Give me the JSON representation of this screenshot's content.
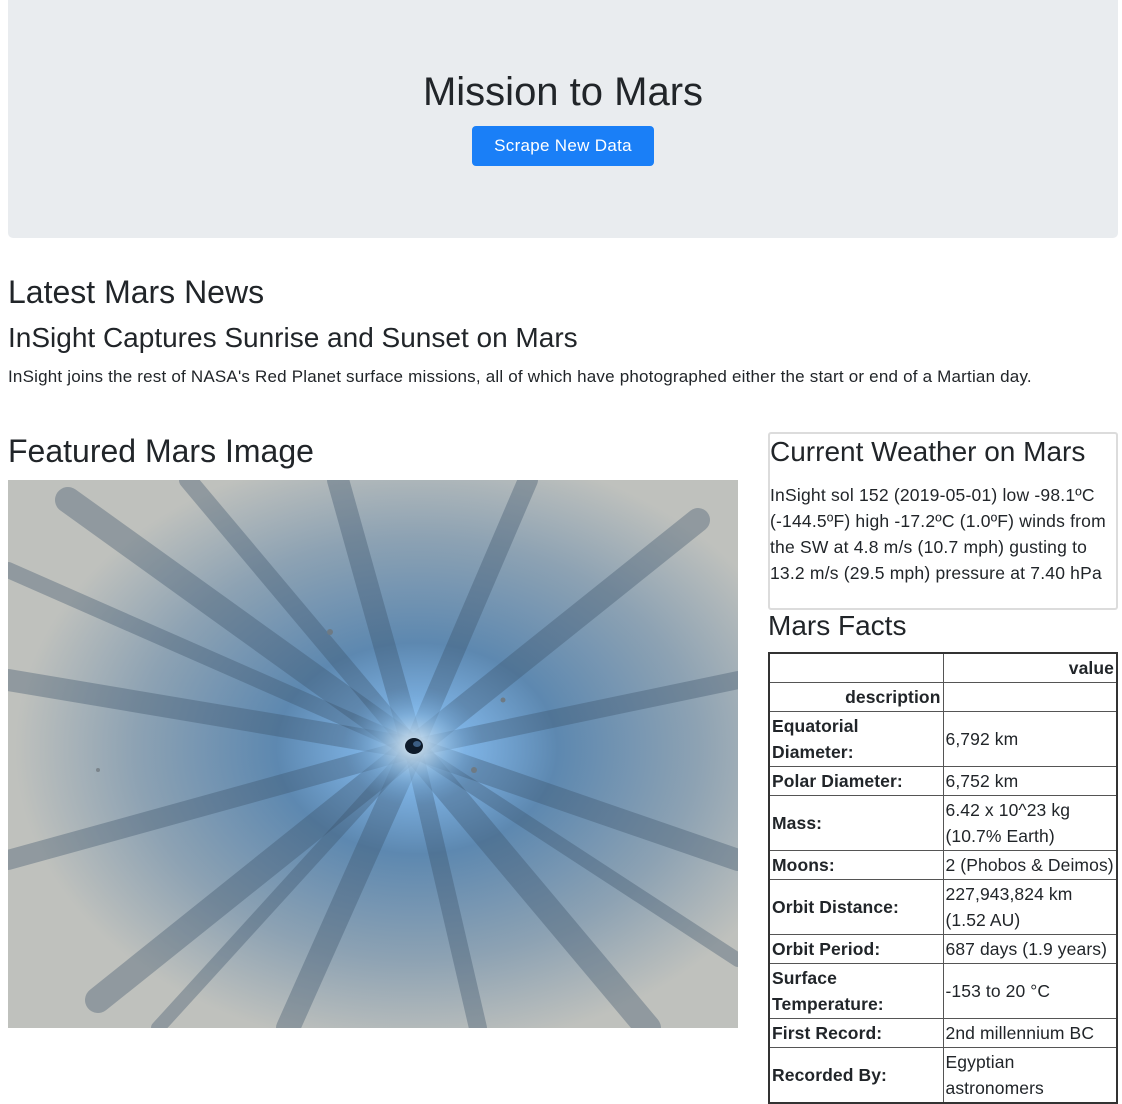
{
  "header": {
    "title": "Mission to Mars",
    "scrape_button_label": "Scrape New Data"
  },
  "news": {
    "section_heading": "Latest Mars News",
    "title": "InSight Captures Sunrise and Sunset on Mars",
    "paragraph": "InSight joins the rest of NASA's Red Planet surface missions, all of which have photographed either the start or end of a Martian day."
  },
  "featured": {
    "heading": "Featured Mars Image",
    "image_description": "mars-crater-image"
  },
  "weather": {
    "heading": "Current Weather on Mars",
    "text": "InSight sol 152 (2019-05-01) low -98.1ºC (-144.5ºF) high -17.2ºC (1.0ºF) winds from the SW at 4.8 m/s (10.7 mph) gusting to 13.2 m/s (29.5 mph) pressure at 7.40 hPa"
  },
  "facts": {
    "heading": "Mars Facts",
    "header_row": [
      "",
      "value"
    ],
    "index_label": "description",
    "rows": [
      {
        "label": "Equatorial Diameter:",
        "value": "6,792 km"
      },
      {
        "label": "Polar Diameter:",
        "value": "6,752 km"
      },
      {
        "label": "Mass:",
        "value": "6.42 x 10^23 kg (10.7% Earth)"
      },
      {
        "label": "Moons:",
        "value": "2 (Phobos & Deimos)"
      },
      {
        "label": "Orbit Distance:",
        "value": "227,943,824 km (1.52 AU)"
      },
      {
        "label": "Orbit Period:",
        "value": "687 days (1.9 years)"
      },
      {
        "label": "Surface Temperature:",
        "value": "-153 to 20 °C"
      },
      {
        "label": "First Record:",
        "value": "2nd millennium BC"
      },
      {
        "label": "Recorded By:",
        "value": "Egyptian astronomers"
      }
    ]
  },
  "colors": {
    "jumbotron_bg": "#e9ecef",
    "button_bg": "#1a7ff7",
    "text": "#212529"
  }
}
